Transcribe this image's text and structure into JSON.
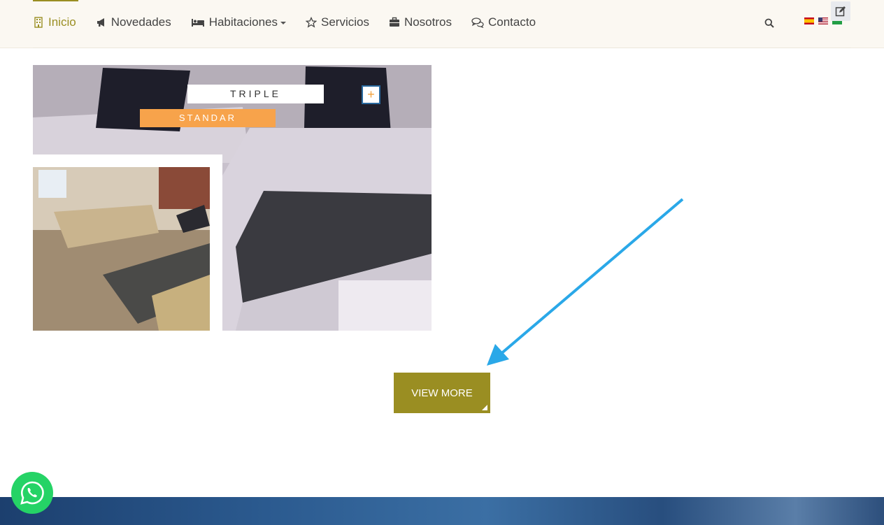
{
  "nav": {
    "items": [
      {
        "label": "Inicio",
        "icon": "building-icon",
        "active": true
      },
      {
        "label": "Novedades",
        "icon": "megaphone-icon"
      },
      {
        "label": "Habitaciones",
        "icon": "bed-icon",
        "dropdown": true
      },
      {
        "label": "Servicios",
        "icon": "star-icon"
      },
      {
        "label": "Nosotros",
        "icon": "briefcase-icon"
      },
      {
        "label": "Contacto",
        "icon": "chat-icon"
      }
    ],
    "search_icon": "search-icon",
    "languages": [
      "es",
      "en",
      "pt"
    ],
    "edit_icon": "edit-icon"
  },
  "room": {
    "title": "TRIPLE",
    "subtitle": "STANDAR",
    "plus": "+"
  },
  "cta": {
    "label": "VIEW MORE"
  },
  "colors": {
    "accent": "#9a8e22",
    "orange": "#f7a34b",
    "whatsapp": "#25d366",
    "arrow": "#2aa8e8"
  }
}
